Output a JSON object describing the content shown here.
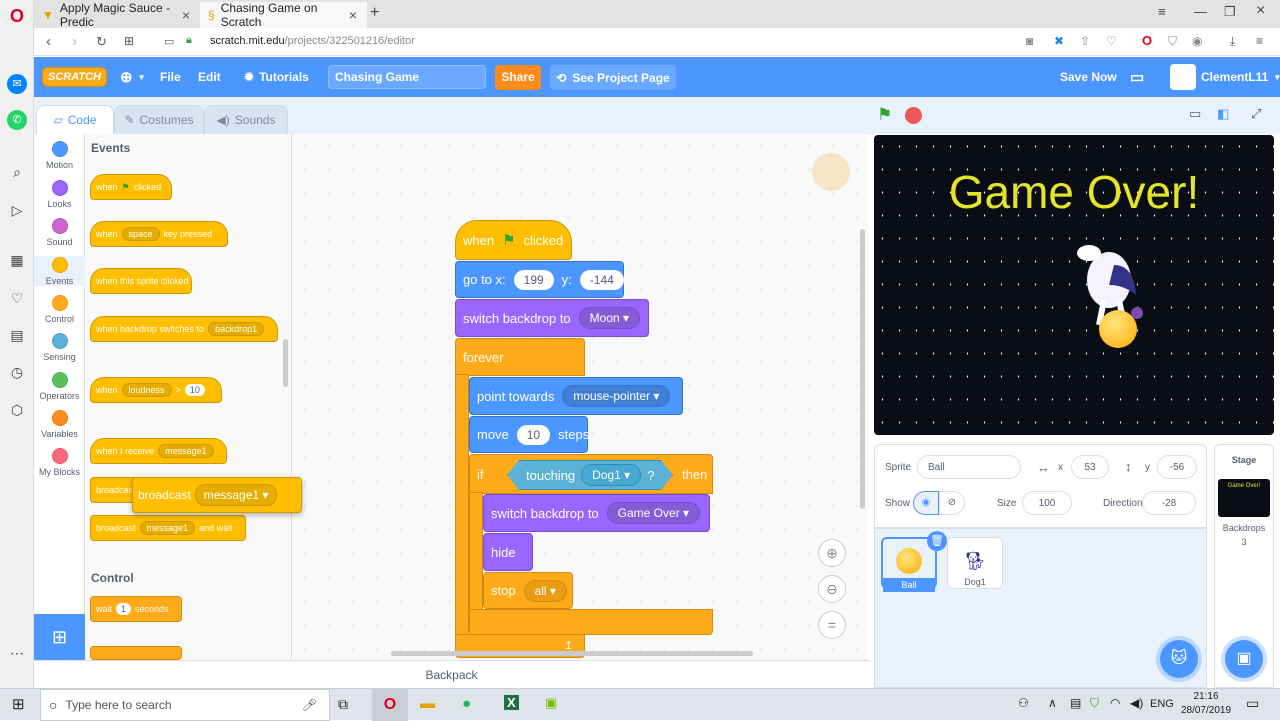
{
  "browser": {
    "tabs": [
      {
        "label": "Apply Magic Sauce - Predic"
      },
      {
        "label": "Chasing Game on Scratch"
      }
    ],
    "url_domain": "scratch.mit.edu",
    "url_path": "/projects/322501216/editor"
  },
  "menu": {
    "file": "File",
    "edit": "Edit",
    "tutorials": "Tutorials",
    "project_title": "Chasing Game",
    "share": "Share",
    "see_project_page": "See Project Page",
    "save_now": "Save Now",
    "username": "ClementL11"
  },
  "editor_tabs": {
    "code": "Code",
    "costumes": "Costumes",
    "sounds": "Sounds"
  },
  "categories": [
    {
      "label": "Motion",
      "color": "#4c97ff"
    },
    {
      "label": "Looks",
      "color": "#9966ff"
    },
    {
      "label": "Sound",
      "color": "#cf63cf"
    },
    {
      "label": "Events",
      "color": "#ffbf00"
    },
    {
      "label": "Control",
      "color": "#ffab19"
    },
    {
      "label": "Sensing",
      "color": "#5cb1d6"
    },
    {
      "label": "Operators",
      "color": "#59c059"
    },
    {
      "label": "Variables",
      "color": "#ff8c1a"
    },
    {
      "label": "My Blocks",
      "color": "#ff6680"
    }
  ],
  "palette": {
    "events_header": "Events",
    "control_header": "Control",
    "when_flag_clicked_a": "when",
    "when_flag_clicked_b": "clicked",
    "when_key_a": "when",
    "when_key_value": "space",
    "when_key_b": "key pressed",
    "when_sprite_clicked": "when this sprite clicked",
    "when_backdrop_a": "when backdrop switches to",
    "when_backdrop_value": "backdrop1",
    "when_loudness_a": "when",
    "when_loudness_value": "loudness",
    "when_loudness_op": ">",
    "when_loudness_num": "10",
    "when_receive_a": "when I receive",
    "when_receive_value": "message1",
    "broadcast_a": "broadcast",
    "broadcast_wait_a": "broadcast",
    "broadcast_wait_value": "message1",
    "broadcast_wait_b": "and wait",
    "wait_a": "wait",
    "wait_num": "1",
    "wait_b": "seconds"
  },
  "dragging_block": {
    "label": "broadcast",
    "value": "message1"
  },
  "script": {
    "hat_when": "when",
    "hat_clicked": "clicked",
    "goto_label": "go to x:",
    "goto_x": "199",
    "goto_y_label": "y:",
    "goto_y": "-144",
    "switch_backdrop_label": "switch backdrop to",
    "switch_backdrop_value": "Moon",
    "forever": "forever",
    "point_towards": "point towards",
    "point_value": "mouse-pointer",
    "move": "move",
    "move_steps": "10",
    "steps": "steps",
    "if": "if",
    "touching": "touching",
    "touching_value": "Dog1",
    "touching_q": "?",
    "then": "then",
    "switch_backdrop2_label": "switch backdrop to",
    "switch_backdrop2_value": "Game Over",
    "hide": "hide",
    "stop": "stop",
    "stop_value": "all"
  },
  "backpack": "Backpack",
  "stage": {
    "text": "Game Over!"
  },
  "sprite_info": {
    "sprite_label": "Sprite",
    "sprite_name": "Ball",
    "x_label": "x",
    "x": "53",
    "y_label": "y",
    "y": "-56",
    "show_label": "Show",
    "size_label": "Size",
    "size": "100",
    "direction_label": "Direction",
    "direction": "-28"
  },
  "sprites": [
    {
      "name": "Ball"
    },
    {
      "name": "Dog1"
    }
  ],
  "stage_panel": {
    "title": "Stage",
    "thumb_text": "Game Over!",
    "backdrops_label": "Backdrops",
    "backdrops_count": "3"
  },
  "taskbar": {
    "search_placeholder": "Type here to search",
    "lang": "ENG",
    "time": "21:16",
    "date": "28/07/2019"
  }
}
